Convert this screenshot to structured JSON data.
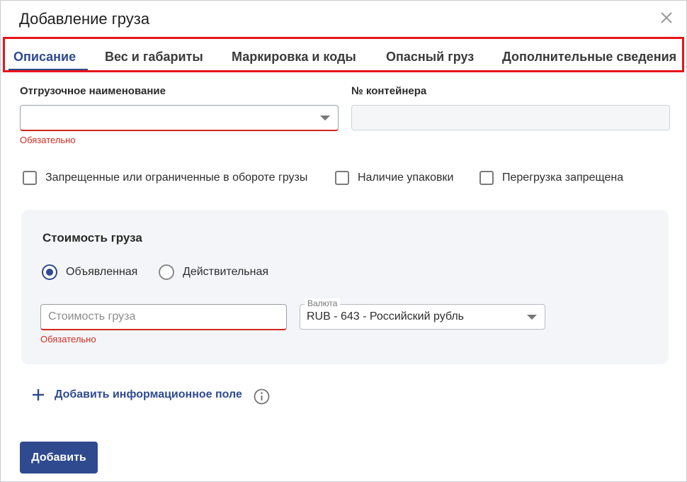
{
  "dialog": {
    "title": "Добавление груза"
  },
  "tabs": [
    {
      "label": "Описание",
      "active": true
    },
    {
      "label": "Вес и габариты",
      "active": false
    },
    {
      "label": "Маркировка и коды",
      "active": false
    },
    {
      "label": "Опасный груз",
      "active": false
    },
    {
      "label": "Дополнительные сведения",
      "active": false
    }
  ],
  "shipping_name": {
    "label": "Отгрузочное наименование",
    "value": "",
    "error": "Обязательно"
  },
  "container": {
    "label": "№ контейнера",
    "value": ""
  },
  "checkboxes": [
    {
      "label": "Запрещенные или ограниченные в обороте грузы",
      "checked": false
    },
    {
      "label": "Наличие упаковки",
      "checked": false
    },
    {
      "label": "Перегрузка запрещена",
      "checked": false
    }
  ],
  "cost_panel": {
    "title": "Стоимость груза",
    "radios": [
      {
        "label": "Объявленная",
        "checked": true
      },
      {
        "label": "Действительная",
        "checked": false
      }
    ],
    "cost_input": {
      "placeholder": "Стоимость груза",
      "value": "",
      "error": "Обязательно"
    },
    "currency": {
      "legend": "Валюта",
      "value": "RUB - 643 - Российский рубль"
    }
  },
  "add_field": {
    "label": "Добавить информационное поле"
  },
  "submit": {
    "label": "Добавить"
  },
  "colors": {
    "accent": "#2f4a8f",
    "error": "#d0281f",
    "highlight_frame": "#e8141b",
    "panel_bg": "#f4f5f9"
  },
  "icons": {
    "close": "close-icon",
    "dropdown": "chevron-down-icon",
    "add": "plus-icon",
    "info": "info-icon"
  }
}
